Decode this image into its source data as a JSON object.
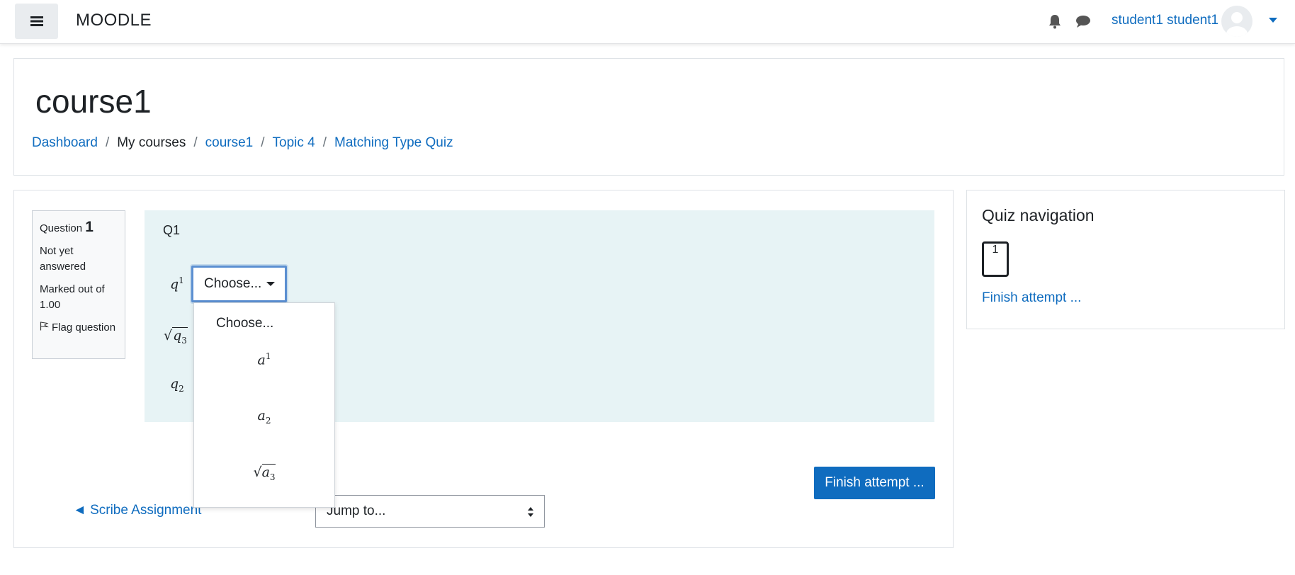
{
  "navbar": {
    "brand": "MOODLE",
    "username": "student1 student1",
    "icons": [
      "hamburger-icon",
      "bell-icon",
      "chat-icon",
      "avatar-icon"
    ]
  },
  "header": {
    "course_title": "course1",
    "breadcrumb": [
      {
        "label": "Dashboard",
        "link": true
      },
      {
        "label": "My courses",
        "link": false
      },
      {
        "label": "course1",
        "link": true
      },
      {
        "label": "Topic 4",
        "link": true
      },
      {
        "label": "Matching Type Quiz",
        "link": true
      }
    ]
  },
  "question_info": {
    "question_label": "Question",
    "question_number": "1",
    "status": "Not yet answered",
    "marked": "Marked out of 1.00",
    "flag_label": "Flag question"
  },
  "question": {
    "text": "Q1",
    "stems": [
      {
        "base": "q",
        "sup": "1",
        "sub": ""
      },
      {
        "base": "q",
        "sup": "",
        "sub": "3",
        "sqrt": true
      },
      {
        "base": "q",
        "sup": "",
        "sub": "2"
      }
    ],
    "select_value": "Choose..."
  },
  "dropdown": {
    "options": [
      {
        "label": "Choose..."
      },
      {
        "base": "a",
        "sup": "1",
        "sub": ""
      },
      {
        "base": "a",
        "sup": "",
        "sub": "2"
      },
      {
        "base": "a",
        "sup": "",
        "sub": "3",
        "sqrt": true
      }
    ]
  },
  "footer": {
    "finish_button": "Finish attempt ...",
    "prev_link": "◄ Scribe Assignment",
    "jump_select": "Jump to..."
  },
  "quiz_nav": {
    "title": "Quiz navigation",
    "buttons": [
      "1"
    ],
    "finish_link": "Finish attempt ..."
  },
  "colors": {
    "link": "#0f6cbf",
    "primary_button": "#0f6cbf",
    "question_bg": "#e7f3f5",
    "info_bg": "#f8f9fa"
  }
}
